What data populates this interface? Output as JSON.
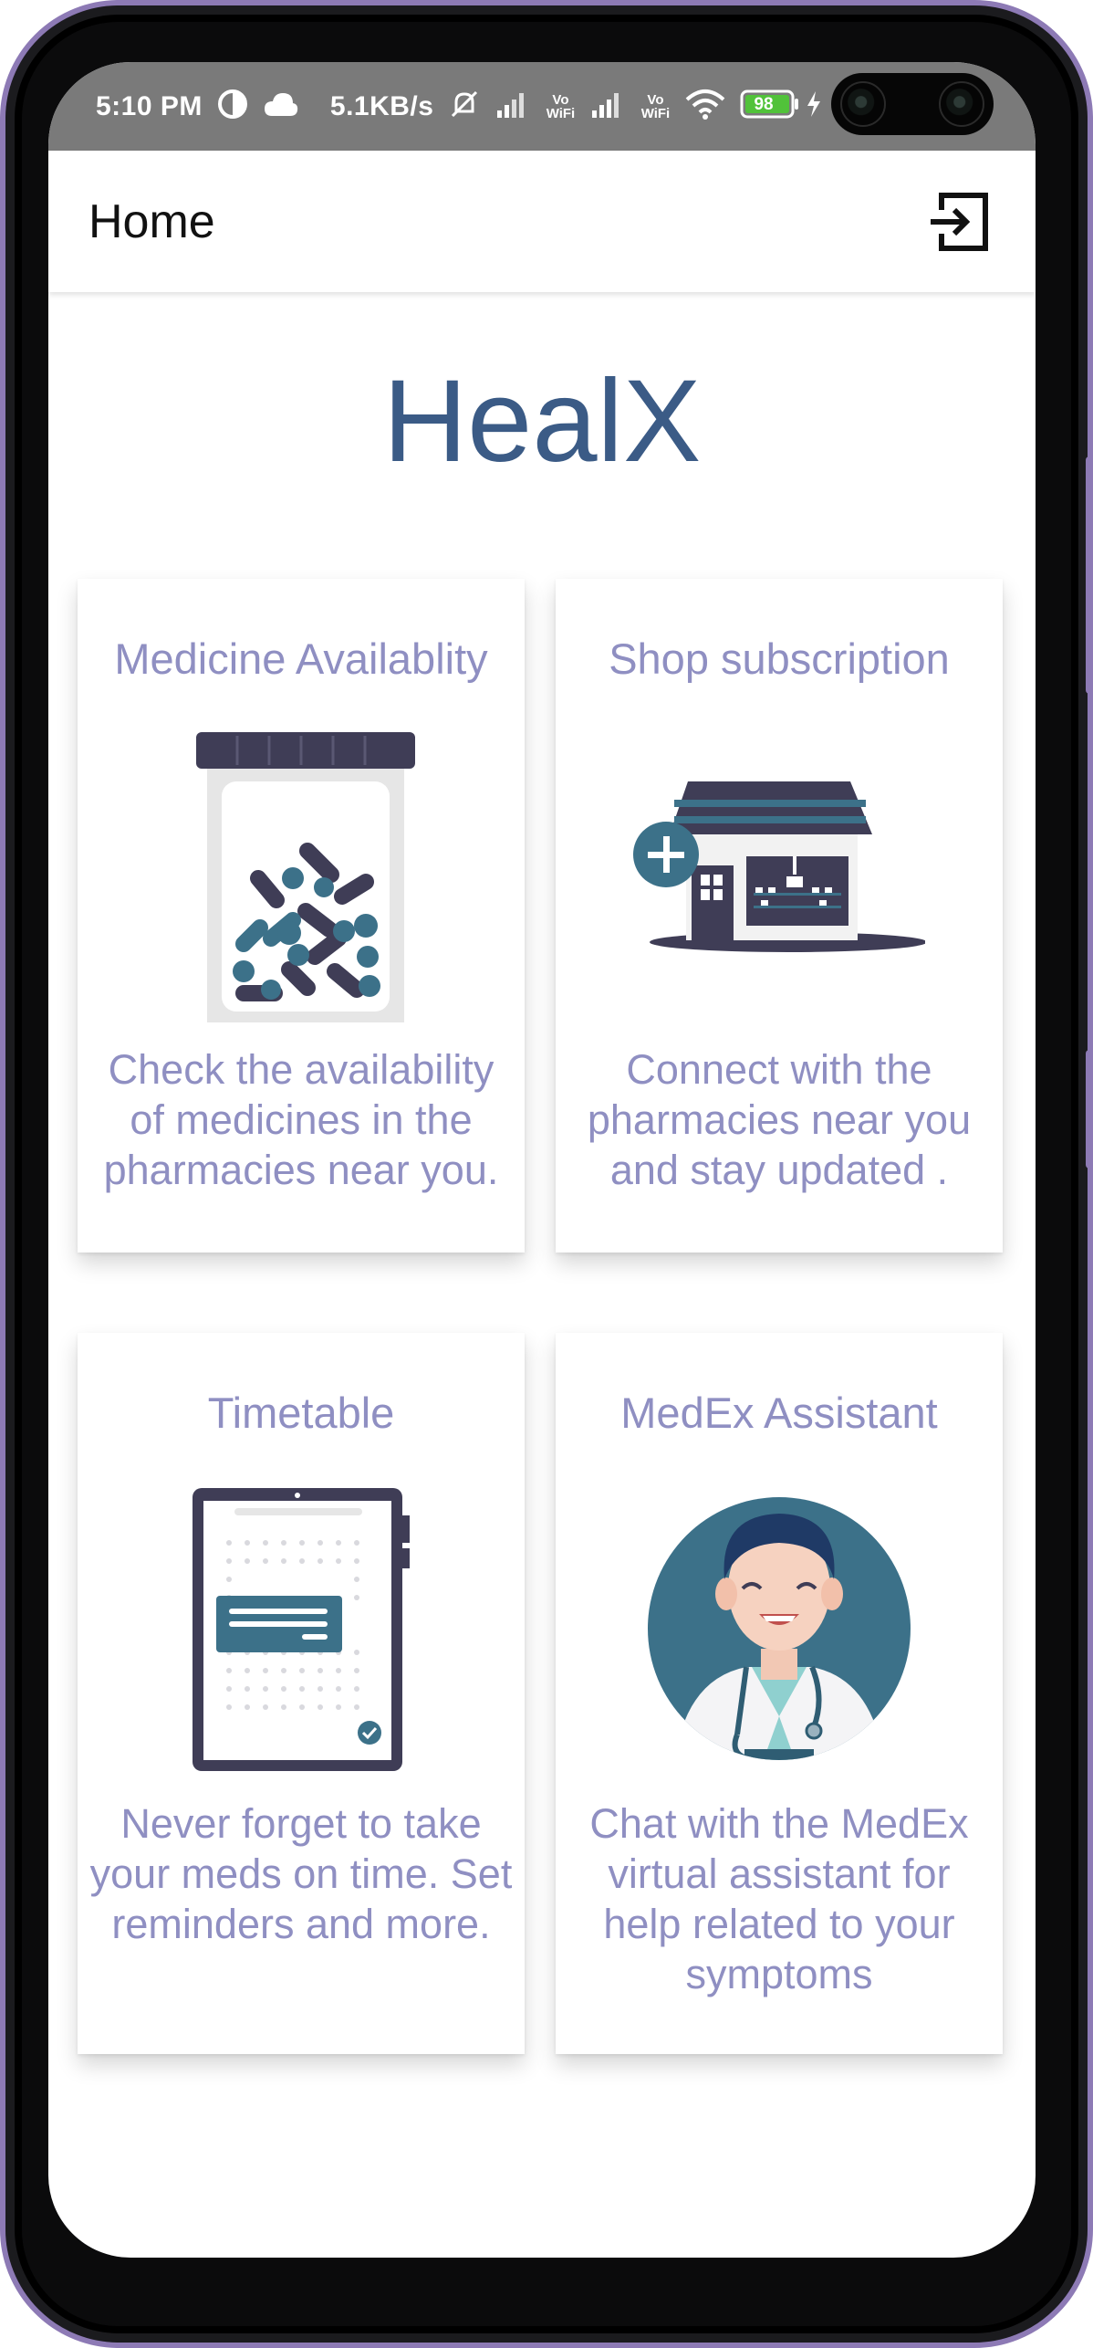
{
  "status_bar": {
    "time": "5:10 PM",
    "network_speed": "5.1KB/s",
    "battery_level": "98",
    "volte_label_1": "Vo WiFi",
    "volte_label_2": "Vo WiFi",
    "icons": [
      "data-saver-icon",
      "cloud-icon",
      "silent-icon",
      "signal-icon",
      "wifi-icon",
      "battery-icon",
      "charging-icon"
    ]
  },
  "app_bar": {
    "title": "Home",
    "logout_icon": "logout-icon"
  },
  "brand": {
    "name": "HealX",
    "color": "#3b5b86"
  },
  "cards": [
    {
      "title": "Medicine Availablity",
      "description": "Check the availability of medicines in the pharmacies near you.",
      "illustration": "pill-jar-icon"
    },
    {
      "title": "Shop subscription",
      "description": "Connect with the pharmacies near you and stay updated .",
      "illustration": "pharmacy-shop-icon"
    },
    {
      "title": "Timetable",
      "description": "Never forget to take your meds on time. Set reminders and more.",
      "illustration": "tablet-timetable-icon"
    },
    {
      "title": "MedEx Assistant",
      "description": "Chat with the MedEx virtual assistant for help related to your symptoms",
      "illustration": "doctor-avatar-icon"
    }
  ],
  "colors": {
    "card_text": "#8f8fc2",
    "status_bar_bg": "#7a7a7a",
    "illustration_dark": "#3f3d56",
    "illustration_teal": "#3c7189"
  }
}
